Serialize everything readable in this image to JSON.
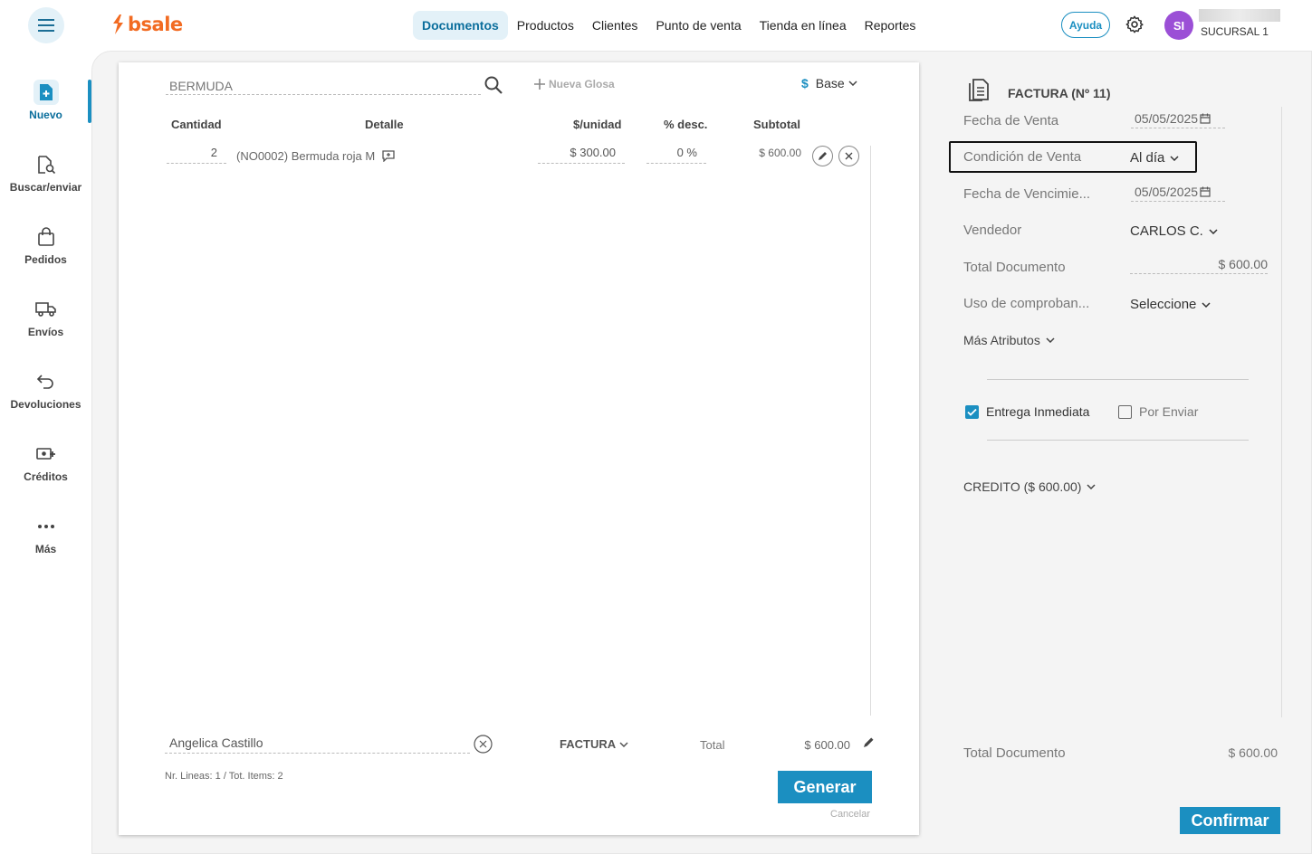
{
  "brand": {
    "logo_text": "bsale",
    "accent": "#1b8fc1",
    "logo_color": "#f26b22"
  },
  "nav": {
    "items": [
      {
        "label": "Documentos",
        "active": true
      },
      {
        "label": "Productos"
      },
      {
        "label": "Clientes"
      },
      {
        "label": "Punto de venta"
      },
      {
        "label": "Tienda en línea"
      },
      {
        "label": "Reportes"
      }
    ]
  },
  "header": {
    "help_label": "Ayuda",
    "avatar_initials": "SI",
    "branch": "SUCURSAL 1"
  },
  "sidebar": {
    "items": [
      {
        "label": "Nuevo",
        "icon": "file-plus-icon",
        "active": true
      },
      {
        "label": "Buscar/enviar",
        "icon": "file-search-icon"
      },
      {
        "label": "Pedidos",
        "icon": "shopping-bag-icon"
      },
      {
        "label": "Envíos",
        "icon": "truck-icon"
      },
      {
        "label": "Devoluciones",
        "icon": "return-arrow-icon"
      },
      {
        "label": "Créditos",
        "icon": "money-plus-icon"
      },
      {
        "label": "Más",
        "icon": "more-dots-icon"
      }
    ]
  },
  "document": {
    "search_value": "BERMUDA",
    "new_gloss_label": "Nueva Glosa",
    "price_list": {
      "symbol": "$",
      "label": "Base"
    },
    "columns": {
      "quantity": "Cantidad",
      "detail": "Detalle",
      "unit_price": "$/unidad",
      "discount": "% desc.",
      "subtotal": "Subtotal"
    },
    "lines": [
      {
        "quantity": "2",
        "detail": "(NO0002) Bermuda roja M",
        "unit_price": "$ 300.00",
        "discount": "0 %",
        "subtotal": "$ 600.00"
      }
    ],
    "client": "Angelica Castillo",
    "doc_type": "FACTURA",
    "total_label": "Total",
    "total_value": "$ 600.00",
    "lines_info": "Nr. Lineas: 1 / Tot. Items: 2",
    "generate_label": "Generar",
    "cancel_label": "Cancelar"
  },
  "summary": {
    "title": "FACTURA (Nº 11)",
    "sale_date_label": "Fecha de Venta",
    "sale_date": "05/05/2025",
    "condition_label": "Condición de Venta",
    "condition_value": "Al día",
    "due_date_label": "Fecha de Vencimie...",
    "due_date": "05/05/2025",
    "seller_label": "Vendedor",
    "seller_value": "CARLOS C.",
    "total_doc_label": "Total Documento",
    "total_doc_value": "$ 600.00",
    "voucher_label": "Uso de comproban...",
    "voucher_value": "Seleccione",
    "more_attrs_label": "Más Atributos",
    "immediate_label": "Entrega Inmediata",
    "immediate_checked": true,
    "to_ship_label": "Por Enviar",
    "to_ship_checked": false,
    "credit_label": "CREDITO ($ 600.00)",
    "footer_total_label": "Total Documento",
    "footer_total_value": "$ 600.00",
    "confirm_label": "Confirmar"
  }
}
